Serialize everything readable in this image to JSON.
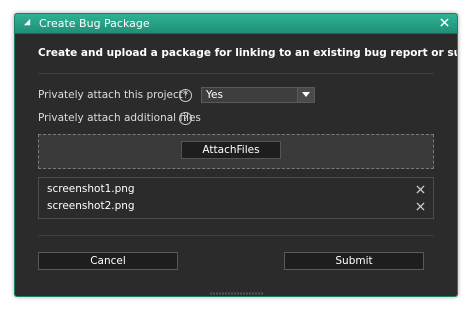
{
  "window": {
    "title": "Create Bug Package"
  },
  "heading": "Create and upload a package for linking to an existing bug report or support ticket.",
  "fields": {
    "attach_project_label": "Privately attach this project*",
    "attach_project_value": "Yes",
    "attach_files_label": "Privately attach additional files"
  },
  "attach_button": "AttachFiles",
  "files": [
    "screenshot1.png",
    "screenshot2.png"
  ],
  "buttons": {
    "cancel": "Cancel",
    "submit": "Submit"
  },
  "icons": {
    "title": "collapse-caret-icon",
    "close": "close-icon",
    "help": "help-circle-icon",
    "dropdown": "chevron-down-icon",
    "remove": "remove-icon",
    "resize": "resize-grip-icon"
  },
  "colors": {
    "titlebar": "#2fb395",
    "dialog_bg": "#2b2b2b",
    "button_bg": "#1e1e1e",
    "text": "#ffffff"
  }
}
